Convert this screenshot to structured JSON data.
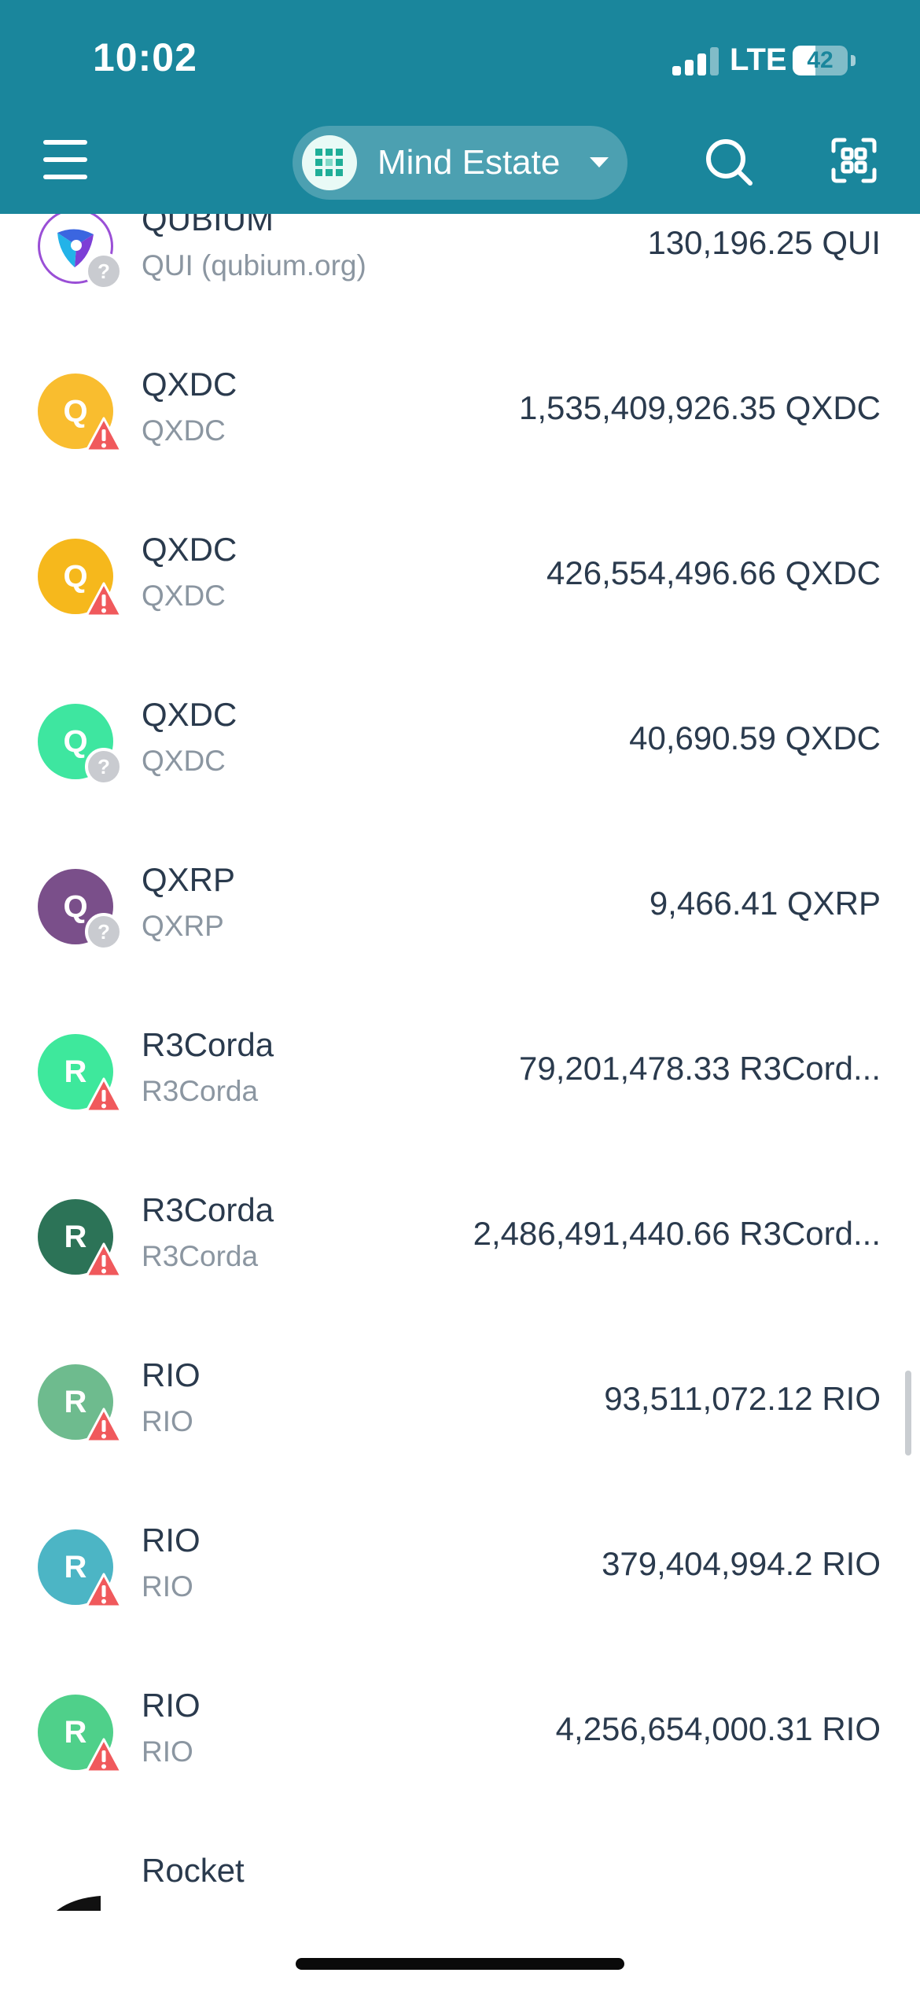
{
  "status_bar": {
    "time": "10:02",
    "network": "LTE",
    "battery": "42",
    "battery_level": 0.42
  },
  "header": {
    "wallet_name": "Mind Estate",
    "icons": {
      "menu": "hamburger-menu-icon",
      "search": "search-icon",
      "scan": "qr-scan-icon",
      "caret": "caret-down-icon"
    }
  },
  "tokens": [
    {
      "name": "QUBIUM",
      "symbol": "QUI (qubium.org)",
      "balance": "130,196.25 QUI",
      "icon_letter": "",
      "icon_color": "#ffffff",
      "badge": "unknown"
    },
    {
      "name": "QXDC",
      "symbol": "QXDC",
      "balance": "1,535,409,926.35 QXDC",
      "icon_letter": "Q",
      "icon_color": "#f9bd2f",
      "badge": "warning"
    },
    {
      "name": "QXDC",
      "symbol": "QXDC",
      "balance": "426,554,496.66 QXDC",
      "icon_letter": "Q",
      "icon_color": "#f6b81c",
      "badge": "warning"
    },
    {
      "name": "QXDC",
      "symbol": "QXDC",
      "balance": "40,690.59 QXDC",
      "icon_letter": "Q",
      "icon_color": "#3ee6a0",
      "badge": "unknown"
    },
    {
      "name": "QXRP",
      "symbol": "QXRP",
      "balance": "9,466.41 QXRP",
      "icon_letter": "Q",
      "icon_color": "#7a4f8a",
      "badge": "unknown"
    },
    {
      "name": "R3Corda",
      "symbol": "R3Corda",
      "balance": "79,201,478.33 R3Cord...",
      "icon_letter": "R",
      "icon_color": "#3ee89c",
      "badge": "warning"
    },
    {
      "name": "R3Corda",
      "symbol": "R3Corda",
      "balance": "2,486,491,440.66 R3Cord...",
      "icon_letter": "R",
      "icon_color": "#2c7357",
      "badge": "warning"
    },
    {
      "name": "RIO",
      "symbol": "RIO",
      "balance": "93,511,072.12 RIO",
      "icon_letter": "R",
      "icon_color": "#6ebb8e",
      "badge": "warning"
    },
    {
      "name": "RIO",
      "symbol": "RIO",
      "balance": "379,404,994.2 RIO",
      "icon_letter": "R",
      "icon_color": "#4cb5c5",
      "badge": "warning"
    },
    {
      "name": "RIO",
      "symbol": "RIO",
      "balance": "4,256,654,000.31 RIO",
      "icon_letter": "R",
      "icon_color": "#4fd08a",
      "badge": "warning"
    },
    {
      "name": "Rocket",
      "symbol": "",
      "balance": "",
      "icon_letter": "",
      "icon_color": "#111111",
      "badge": "none"
    }
  ],
  "colors": {
    "header": "#1a869c",
    "text": "#2a3a4d",
    "muted": "#8b96a1",
    "warning": "#f0595c",
    "unknown_badge": "#c9cbd0"
  }
}
